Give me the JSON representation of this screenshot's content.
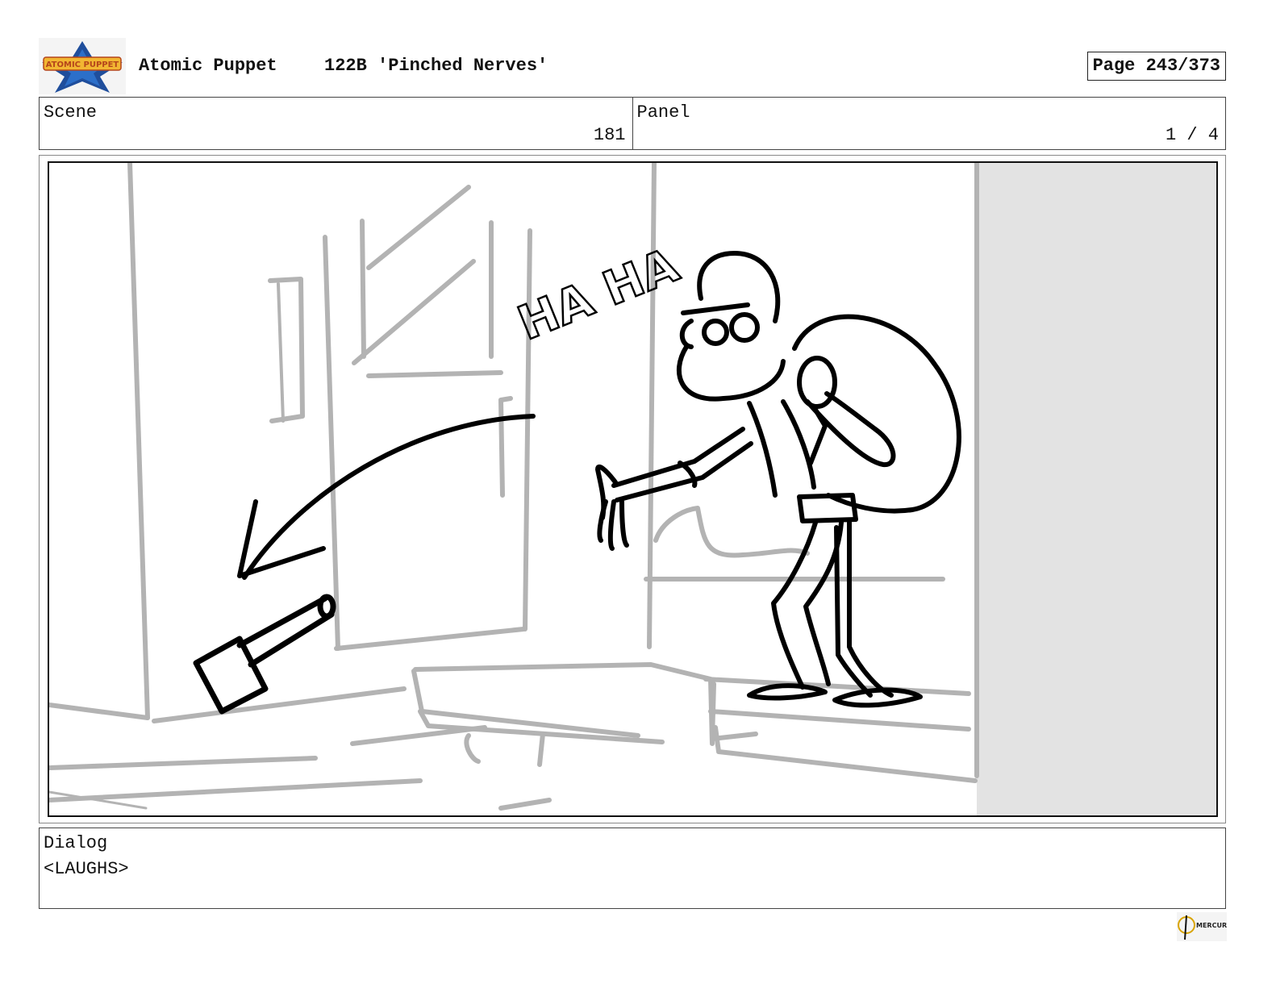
{
  "header": {
    "show_name": "Atomic Puppet",
    "episode": "122B 'Pinched Nerves'",
    "page": "Page 243/373",
    "logo_text": "ATOMIC PUPPET"
  },
  "info": {
    "scene_label": "Scene",
    "scene_value": "181",
    "panel_label": "Panel",
    "panel_value": "1 / 4"
  },
  "panel": {
    "sfx_text": "HA HA"
  },
  "dialog": {
    "label": "Dialog",
    "text": "<LAUGHS>"
  },
  "footer": {
    "badge_text": "MERCURY"
  },
  "colors": {
    "background_sketch": "#b3b3b3",
    "foreground_ink": "#000000",
    "offscreen_fill": "#e3e3e3",
    "logo_blue": "#1f4e9c",
    "logo_gold": "#f2b632"
  }
}
